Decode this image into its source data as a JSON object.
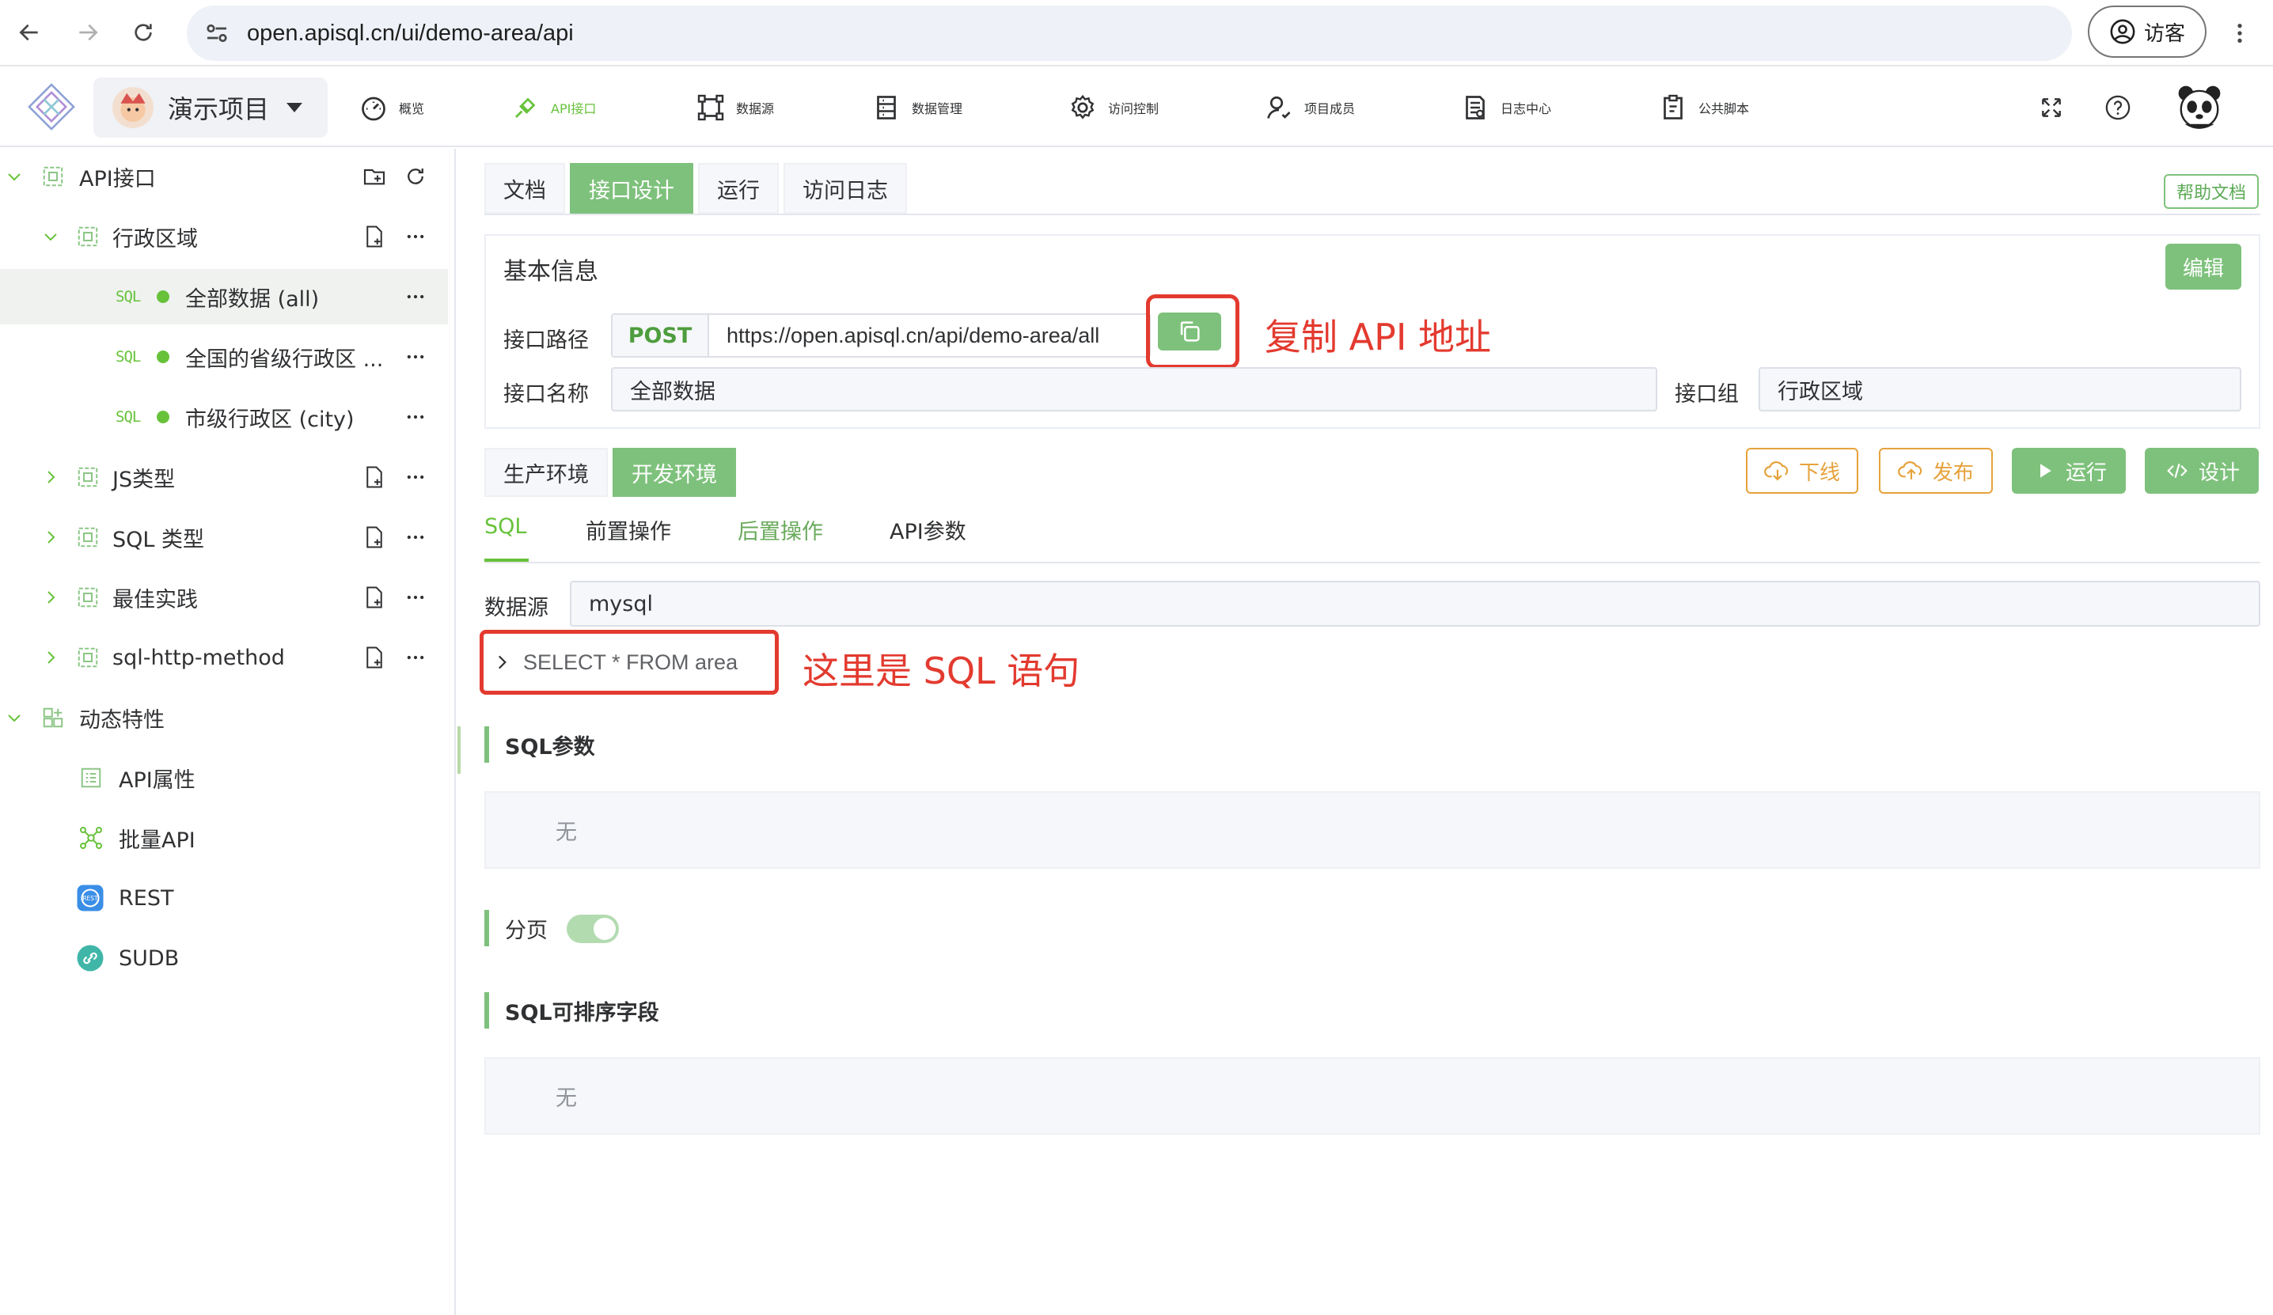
{
  "browser": {
    "url": "open.apisql.cn/ui/demo-area/api",
    "profile_label": "访客"
  },
  "header": {
    "project": "演示项目",
    "menu": [
      {
        "label": "概览",
        "icon": "dashboard-icon"
      },
      {
        "label": "API接口",
        "icon": "api-icon",
        "active": true
      },
      {
        "label": "数据源",
        "icon": "datasource-icon"
      },
      {
        "label": "数据管理",
        "icon": "data-manage-icon"
      },
      {
        "label": "访问控制",
        "icon": "gear-icon"
      },
      {
        "label": "项目成员",
        "icon": "members-icon"
      },
      {
        "label": "日志中心",
        "icon": "log-icon"
      },
      {
        "label": "公共脚本",
        "icon": "script-icon"
      }
    ]
  },
  "sidebar": {
    "items": [
      {
        "label": "API接口"
      },
      {
        "label": "行政区域"
      },
      {
        "tag": "SQL",
        "label": "全部数据 (all)"
      },
      {
        "tag": "SQL",
        "label": "全国的省级行政区 ..."
      },
      {
        "tag": "SQL",
        "label": "市级行政区 (city)"
      },
      {
        "label": "JS类型"
      },
      {
        "label": "SQL 类型"
      },
      {
        "label": "最佳实践"
      },
      {
        "label": "sql-http-method"
      },
      {
        "label": "动态特性"
      },
      {
        "label": "API属性"
      },
      {
        "label": "批量API"
      },
      {
        "label": "REST"
      },
      {
        "label": "SUDB"
      }
    ]
  },
  "main": {
    "tabs": [
      "文档",
      "接口设计",
      "运行",
      "访问日志"
    ],
    "help_doc": "帮助文档",
    "basic_info": {
      "title": "基本信息",
      "edit": "编辑",
      "path_label": "接口路径",
      "method": "POST",
      "path": "https://open.apisql.cn/api/demo-area/all",
      "name_label": "接口名称",
      "name": "全部数据",
      "group_label": "接口组",
      "group": "行政区域"
    },
    "annotations": {
      "copy_api": "复制 API 地址",
      "sql_statement": "这里是 SQL 语句"
    },
    "env_tabs": [
      "生产环境",
      "开发环境"
    ],
    "actions": {
      "offline": "下线",
      "publish": "发布",
      "run": "运行",
      "design": "设计"
    },
    "sub_tabs": [
      "SQL",
      "前置操作",
      "后置操作",
      "API参数"
    ],
    "datasource_label": "数据源",
    "datasource": "mysql",
    "sql": "SELECT * FROM area",
    "sql_params_title": "SQL参数",
    "sql_params_empty": "无",
    "paging_label": "分页",
    "paging_on": true,
    "sort_fields_title": "SQL可排序字段",
    "sort_fields_empty": "无"
  },
  "colors": {
    "accent": "#7ec17c",
    "annotation": "#e33a2f",
    "warning": "#e6a23c"
  }
}
